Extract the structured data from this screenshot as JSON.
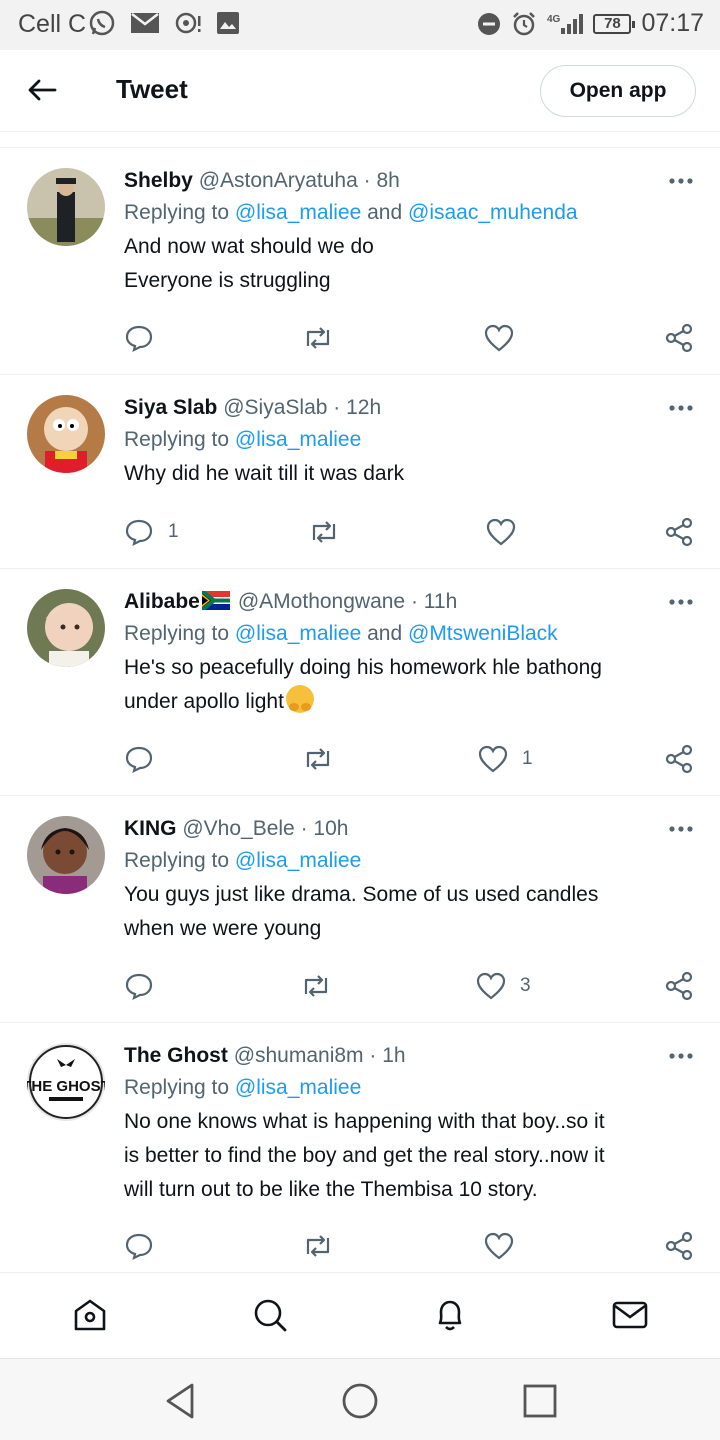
{
  "status_bar": {
    "carrier": "Cell C",
    "battery": "78",
    "time": "07:17"
  },
  "header": {
    "title": "Tweet",
    "open_app_label": "Open app"
  },
  "tweets": [
    {
      "name": "Shelby",
      "handle": "@AstonAryatuha",
      "time": "8h",
      "replying_prefix": "Replying to ",
      "mentions": [
        "@lisa_maliee",
        "@isaac_muhenda"
      ],
      "joiner": " and ",
      "text_lines": [
        "And now wat should we do",
        "Everyone is struggling"
      ],
      "reply_count": "",
      "like_count": ""
    },
    {
      "name": "Siya Slab",
      "handle": "@SiyaSlab",
      "time": "12h",
      "replying_prefix": "Replying to ",
      "mentions": [
        "@lisa_maliee"
      ],
      "text_lines": [
        "Why did he wait till it was dark"
      ],
      "reply_count": "1",
      "like_count": ""
    },
    {
      "name": "Alibabe",
      "handle": "@AMothongwane",
      "time": "11h",
      "replying_prefix": "Replying to ",
      "mentions": [
        "@lisa_maliee",
        "@MtsweniBlack"
      ],
      "joiner": " and ",
      "text_lines": [
        "He's so peacefully doing his homework hle bathong",
        "under apollo light"
      ],
      "reply_count": "",
      "like_count": "1"
    },
    {
      "name": "KING",
      "handle": "@Vho_Bele",
      "time": "10h",
      "replying_prefix": "Replying to ",
      "mentions": [
        "@lisa_maliee"
      ],
      "text_lines": [
        "You guys just like drama. Some of us used candles",
        "when we were young"
      ],
      "reply_count": "",
      "like_count": "3"
    },
    {
      "name": "The Ghost",
      "handle": "@shumani8m",
      "time": "1h",
      "replying_prefix": "Replying to ",
      "mentions": [
        "@lisa_maliee"
      ],
      "text_lines": [
        "No one knows what is happening with that boy..so it",
        "is better to find the boy and get the real story..now it",
        "will turn out to be like the Thembisa 10 story."
      ],
      "reply_count": "",
      "like_count": ""
    }
  ],
  "avatar_logo_text": "THE GHOST",
  "colors": {
    "accent": "#1d9bf0",
    "text": "#0f1419",
    "secondary": "#536471",
    "border": "#eef1f3"
  },
  "icons": {
    "nav": [
      "home-icon",
      "search-icon",
      "notifications-icon",
      "messages-icon"
    ],
    "actions": [
      "reply-icon",
      "retweet-icon",
      "like-icon",
      "share-icon"
    ]
  }
}
